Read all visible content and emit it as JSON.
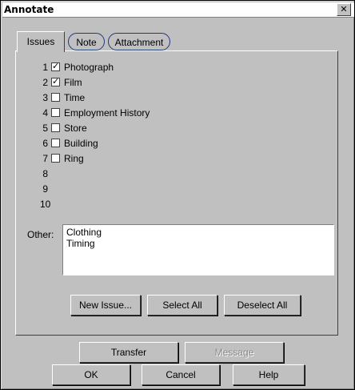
{
  "window": {
    "title": "Annotate",
    "close_glyph": "✕"
  },
  "tabs": [
    {
      "label": "Issues"
    },
    {
      "label": "Note"
    },
    {
      "label": "Attachment"
    }
  ],
  "issues": [
    {
      "num": "1",
      "label": "Photograph",
      "checked": true
    },
    {
      "num": "2",
      "label": "Film",
      "checked": true
    },
    {
      "num": "3",
      "label": "Time",
      "checked": false
    },
    {
      "num": "4",
      "label": "Employment History",
      "checked": false
    },
    {
      "num": "5",
      "label": "Store",
      "checked": false
    },
    {
      "num": "6",
      "label": "Building",
      "checked": false
    },
    {
      "num": "7",
      "label": "Ring",
      "checked": false
    },
    {
      "num": "8",
      "label": "",
      "checked": null
    },
    {
      "num": "9",
      "label": "",
      "checked": null
    },
    {
      "num": "10",
      "label": "",
      "checked": null
    }
  ],
  "other": {
    "label": "Other:",
    "lines": [
      "Clothing",
      "Timing"
    ]
  },
  "panel_buttons": {
    "new_issue": "New Issue...",
    "select_all": "Select All",
    "deselect_all": "Deselect All"
  },
  "footer": {
    "transfer": "Transfer",
    "message": "Message",
    "ok": "OK",
    "cancel": "Cancel",
    "help": "Help"
  },
  "check_glyph": "✓"
}
